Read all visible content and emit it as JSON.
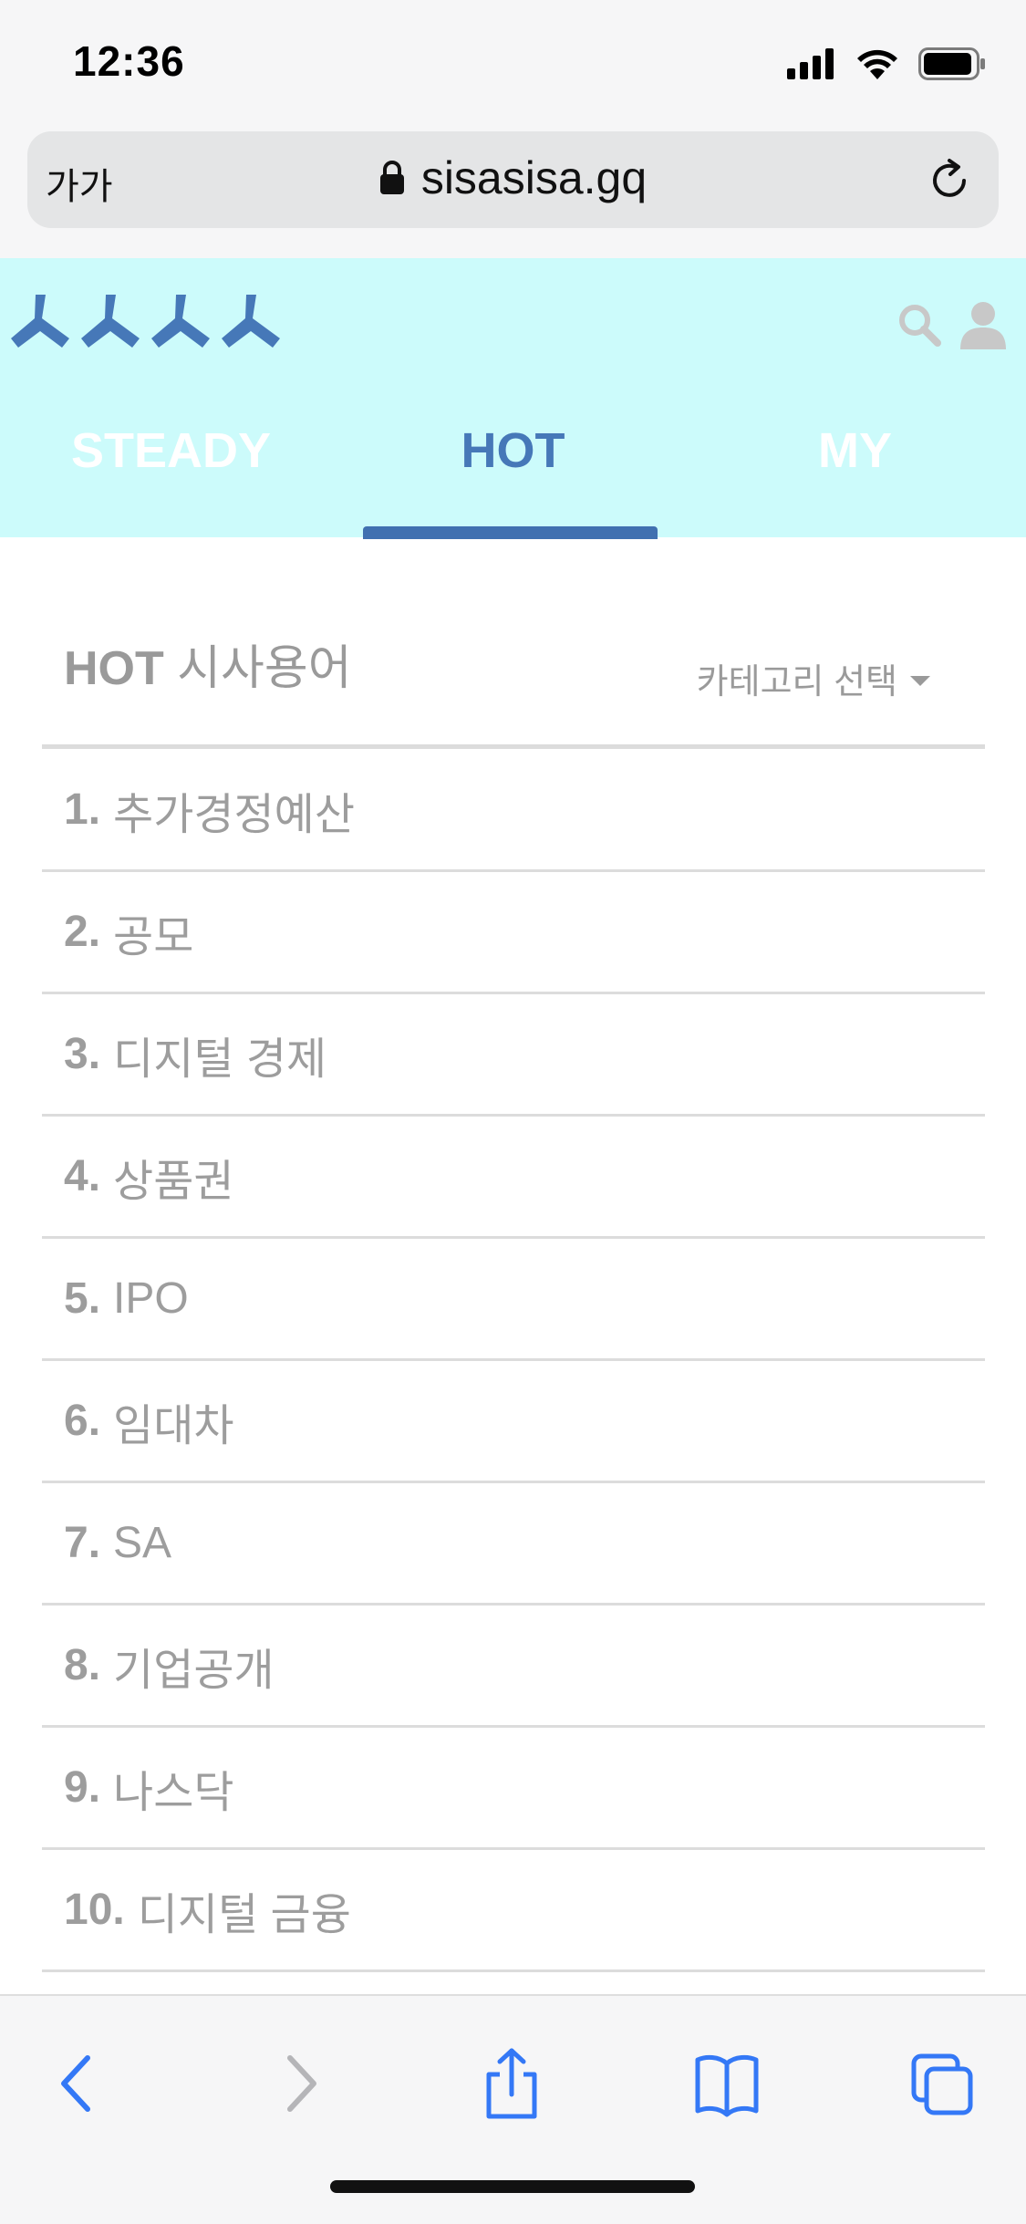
{
  "status_bar": {
    "time": "12:36"
  },
  "browser": {
    "aa_label": "가가",
    "url": "sisasisa.gq"
  },
  "site": {
    "logo_text": "ㅅㅅㅅㅅ",
    "tabs": [
      {
        "label": "STEADY",
        "active": false
      },
      {
        "label": "HOT",
        "active": true
      },
      {
        "label": "MY",
        "active": false
      }
    ]
  },
  "section": {
    "title_bold": "HOT",
    "title_rest": "시사용어",
    "category_label": "카테고리 선택"
  },
  "terms": [
    {
      "num": "1.",
      "term": "추가경정예산"
    },
    {
      "num": "2.",
      "term": "공모"
    },
    {
      "num": "3.",
      "term": "디지털 경제"
    },
    {
      "num": "4.",
      "term": "상품권"
    },
    {
      "num": "5.",
      "term": "IPO"
    },
    {
      "num": "6.",
      "term": "임대차"
    },
    {
      "num": "7.",
      "term": "SA"
    },
    {
      "num": "8.",
      "term": "기업공개"
    },
    {
      "num": "9.",
      "term": "나스닥"
    },
    {
      "num": "10.",
      "term": "디지털 금융"
    }
  ],
  "colors": {
    "header_bg": "#ccfbfb",
    "accent": "#4678b8",
    "muted_text": "#9d9d9d",
    "ios_blue": "#3478f6"
  }
}
